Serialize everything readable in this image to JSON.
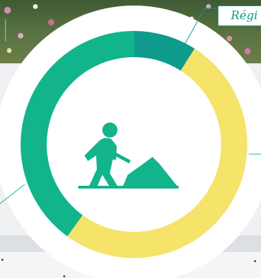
{
  "chart_data": {
    "type": "donut",
    "colors": [
      "#0f9b8e",
      "#f5e36a",
      "#12b48c"
    ],
    "series": [
      {
        "values": [
          9,
          51,
          40
        ]
      }
    ],
    "labels": [
      "Régi"
    ],
    "center_icon": "worker-digging-icon"
  }
}
